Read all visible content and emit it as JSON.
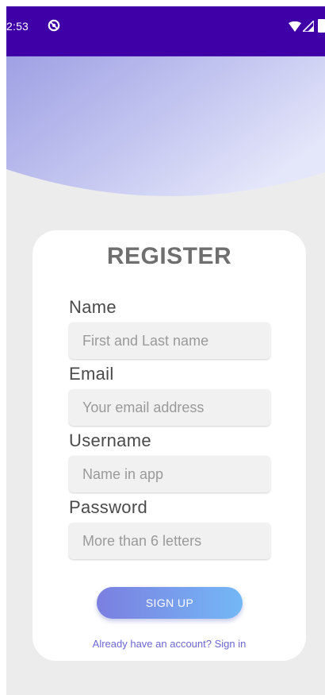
{
  "status_bar": {
    "time": "2:53",
    "background_color": "#3f00a8",
    "icons": [
      "app-notification-icon",
      "wifi-icon",
      "cell-signal-icon",
      "battery-icon"
    ]
  },
  "register": {
    "title": "REGISTER",
    "fields": [
      {
        "label": "Name",
        "placeholder": "First and Last name",
        "value": ""
      },
      {
        "label": "Email",
        "placeholder": "Your email address",
        "value": ""
      },
      {
        "label": "Username",
        "placeholder": "Name in app",
        "value": ""
      },
      {
        "label": "Password",
        "placeholder": "More than 6 letters",
        "value": ""
      }
    ],
    "signup_label": "SIGN UP",
    "signin_link": "Already have an account? Sign in"
  },
  "colors": {
    "accent_purple": "#7b7fe0",
    "accent_blue": "#74b8f6",
    "link": "#6d67d4",
    "page_background": "#ececec",
    "card": "#ffffff"
  }
}
